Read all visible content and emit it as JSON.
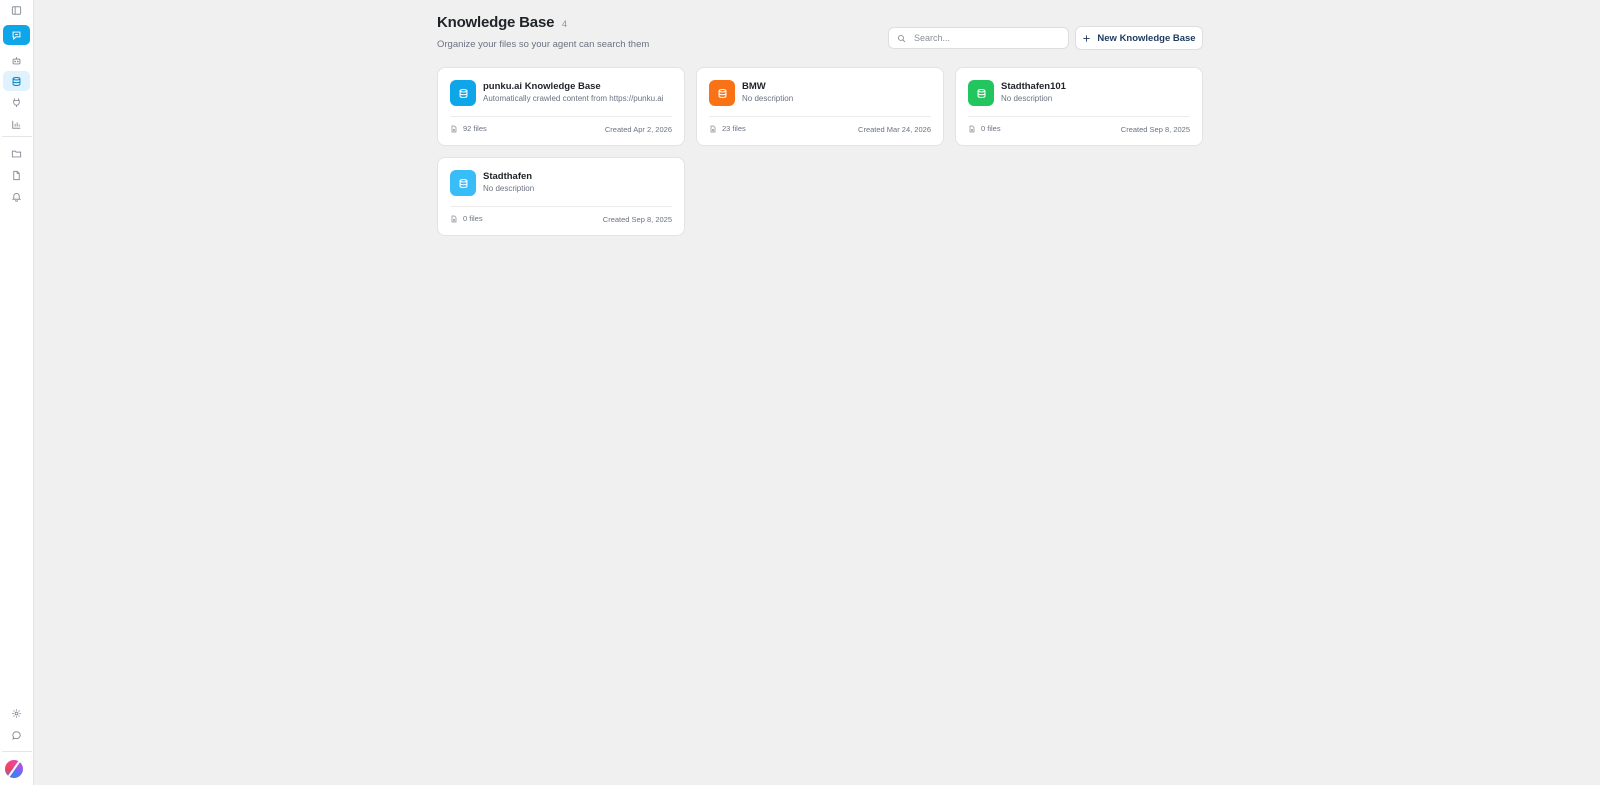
{
  "header": {
    "title": "Knowledge Base",
    "count": "4",
    "subtitle": "Organize your files so your agent can search them"
  },
  "search": {
    "placeholder": "Search..."
  },
  "actions": {
    "new_label": "New Knowledge Base"
  },
  "sidebar": {
    "items": [
      {
        "icon": "sidebar-toggle-icon",
        "active": "none"
      },
      {
        "icon": "chat-icon",
        "active": "primary"
      },
      {
        "icon": "bot-icon",
        "active": "none"
      },
      {
        "icon": "database-icon",
        "active": "soft"
      },
      {
        "icon": "plug-icon",
        "active": "none"
      },
      {
        "icon": "chart-icon",
        "active": "none"
      },
      {
        "icon": "folder-icon",
        "active": "none"
      },
      {
        "icon": "file-icon",
        "active": "none"
      },
      {
        "icon": "bell-icon",
        "active": "none"
      },
      {
        "icon": "gear-icon",
        "active": "none"
      },
      {
        "icon": "message-icon",
        "active": "none"
      }
    ]
  },
  "knowledge_bases": [
    {
      "title": "punku.ai Knowledge Base",
      "description": "Automatically crawled content from https://punku.ai",
      "files": "92 files",
      "created": "Created Apr 2, 2026",
      "color": "#0ea5e9"
    },
    {
      "title": "BMW",
      "description": "No description",
      "files": "23 files",
      "created": "Created Mar 24, 2026",
      "color": "#f97316"
    },
    {
      "title": "Stadthafen101",
      "description": "No description",
      "files": "0 files",
      "created": "Created Sep 8, 2025",
      "color": "#22c55e"
    },
    {
      "title": "Stadthafen",
      "description": "No description",
      "files": "0 files",
      "created": "Created Sep 8, 2025",
      "color": "#38bdf8"
    }
  ]
}
